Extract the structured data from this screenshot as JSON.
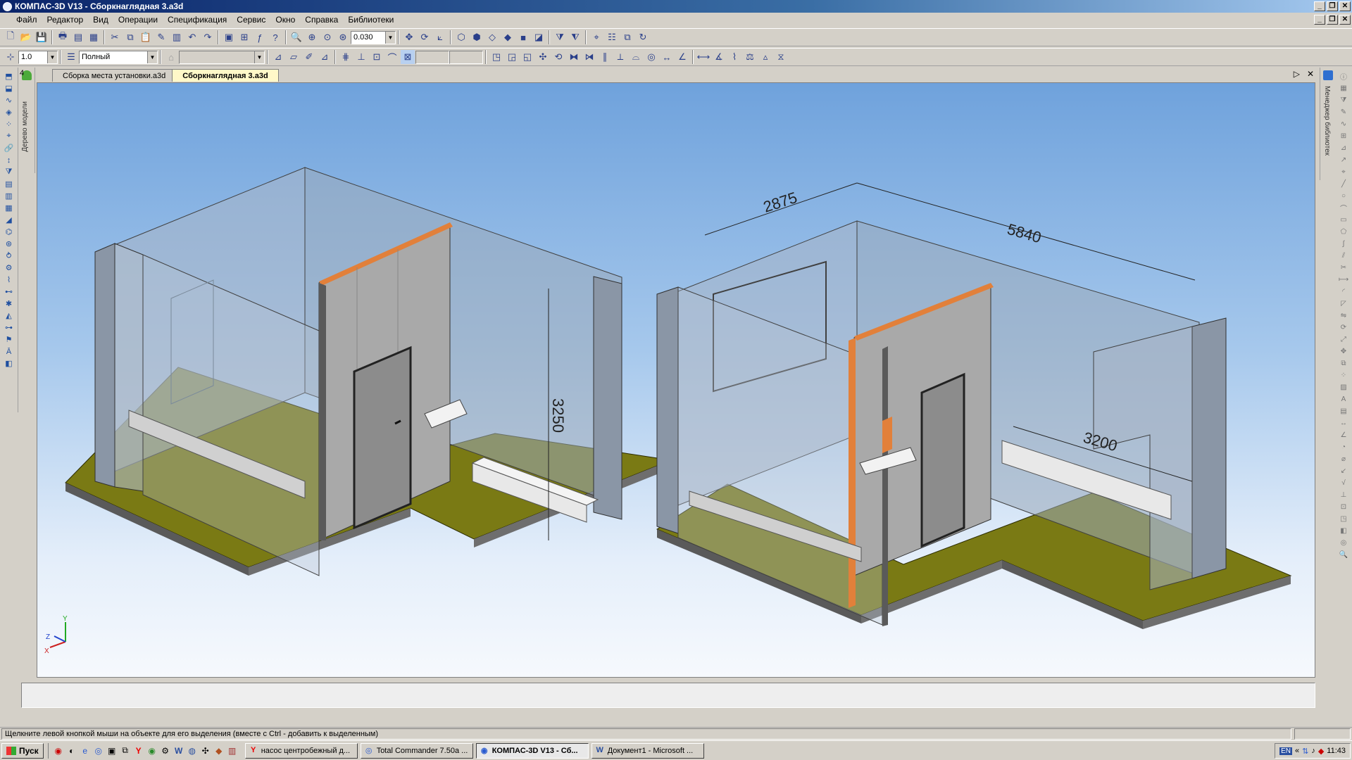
{
  "window": {
    "title": "КОМПАС-3D V13 - Сборкнаглядная 3.a3d",
    "minimize": "_",
    "restore": "❐",
    "close": "✕"
  },
  "menu": [
    "Файл",
    "Редактор",
    "Вид",
    "Операции",
    "Спецификация",
    "Сервис",
    "Окно",
    "Справка",
    "Библиотеки"
  ],
  "toolbar": {
    "zoom_value": "0.030",
    "step_value": "1.0",
    "view_mode": "Полный"
  },
  "tabs": {
    "back_arrow": "4",
    "items": [
      {
        "label": "Сборка места установки.a3d",
        "active": false
      },
      {
        "label": "Сборкнаглядная 3.a3d",
        "active": true
      }
    ],
    "next_arrow": "▷",
    "close_x": "✕"
  },
  "side_panels": {
    "model_tree": "Дерево модели",
    "library_manager": "Менеджер библиотек"
  },
  "model": {
    "dimensions": {
      "height_left": "3250",
      "width_a": "2875",
      "length_b": "5840",
      "width_c": "3200"
    },
    "axes": {
      "x": "X",
      "y": "Y",
      "z": "Z"
    },
    "colors": {
      "floor": "#7a7a14",
      "wall_glass": "#9aa8b8",
      "partition": "#a9a9a9",
      "frame": "#5a5a5a",
      "trim": "#e2803a"
    }
  },
  "status": {
    "hint": "Щелкните левой кнопкой мыши на объекте для его выделения (вместе с Ctrl - добавить к выделенным)"
  },
  "taskbar": {
    "start": "Пуск",
    "tasks": [
      {
        "label": "насос центробежный д...",
        "icon": "Y",
        "active": false
      },
      {
        "label": "Total Commander 7.50a ...",
        "icon": "◎",
        "active": false
      },
      {
        "label": "КОМПАС-3D V13 - Сб...",
        "icon": "◉",
        "active": true
      },
      {
        "label": "Документ1 - Microsoft ...",
        "icon": "W",
        "active": false
      }
    ],
    "lang": "EN",
    "clock": "11:43",
    "tray_chevron": "«"
  }
}
